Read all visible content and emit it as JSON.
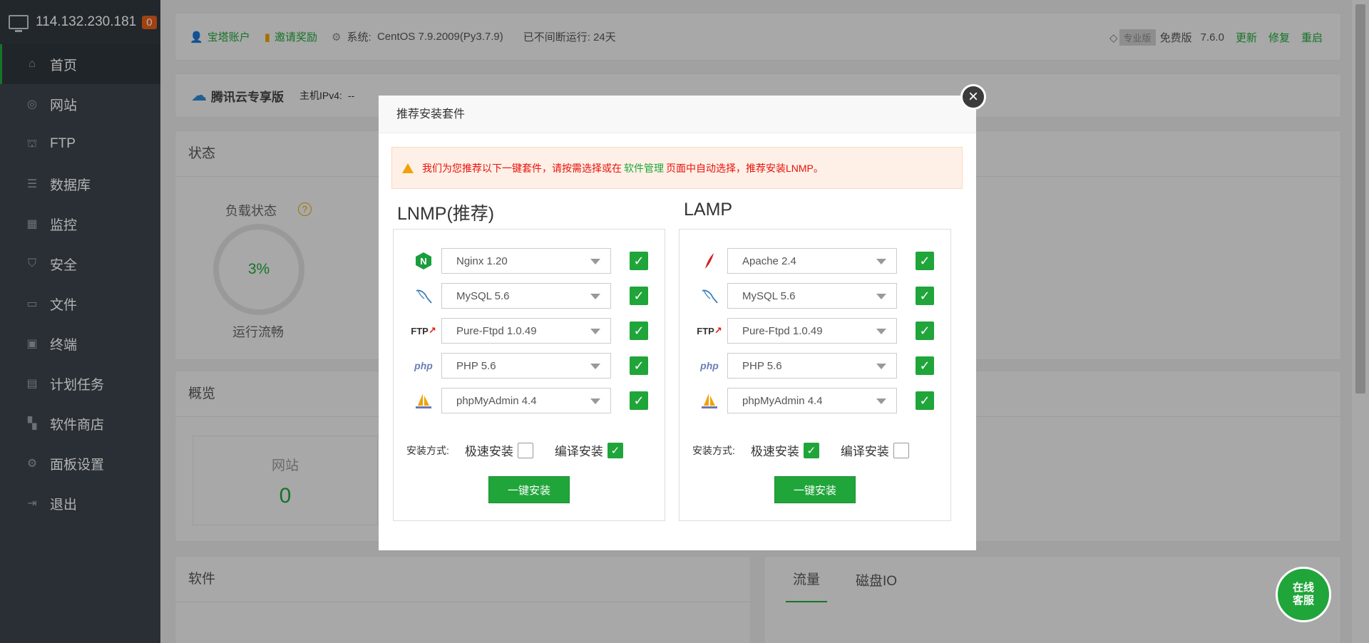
{
  "sidebar": {
    "ip": "114.132.230.181",
    "badge": "0",
    "items": [
      {
        "label": "首页",
        "icon": "home-icon"
      },
      {
        "label": "网站",
        "icon": "globe-icon"
      },
      {
        "label": "FTP",
        "icon": "ftp-icon"
      },
      {
        "label": "数据库",
        "icon": "database-icon"
      },
      {
        "label": "监控",
        "icon": "monitor-icon"
      },
      {
        "label": "安全",
        "icon": "shield-icon"
      },
      {
        "label": "文件",
        "icon": "folder-icon"
      },
      {
        "label": "终端",
        "icon": "terminal-icon"
      },
      {
        "label": "计划任务",
        "icon": "calendar-icon"
      },
      {
        "label": "软件商店",
        "icon": "grid-icon"
      },
      {
        "label": "面板设置",
        "icon": "gear-icon"
      },
      {
        "label": "退出",
        "icon": "logout-icon"
      }
    ]
  },
  "topbar": {
    "account": "宝塔账户",
    "invite": "邀请奖励",
    "system_label": "系统:",
    "system_value": "CentOS 7.9.2009(Py3.7.9)",
    "uptime": "已不间断运行: 24天",
    "pro": "专业版",
    "free": "免费版",
    "version": "7.6.0",
    "update": "更新",
    "repair": "修复",
    "restart": "重启"
  },
  "tencent": {
    "brand": "腾讯云专享版",
    "host_label": "主机IPv4:",
    "host_value": "--"
  },
  "status": {
    "title": "状态",
    "load_label": "负载状态",
    "load_value": "3%",
    "load_state": "运行流畅"
  },
  "overview": {
    "title": "概览",
    "site_label": "网站",
    "site_value": "0"
  },
  "software": {
    "title": "软件"
  },
  "traffic": {
    "tab1": "流量",
    "tab2": "磁盘IO"
  },
  "modal": {
    "title": "推荐安装套件",
    "notice_before": "我们为您推荐以下一键套件，请按需选择或在",
    "notice_link": "软件管理",
    "notice_after": "页面中自动选择，推荐安装LNMP。",
    "lnmp": {
      "title": "LNMP(推荐)",
      "rows": [
        {
          "icon": "nginx-icon",
          "value": "Nginx 1.20",
          "checked": true
        },
        {
          "icon": "mysql-icon",
          "value": "MySQL 5.6",
          "checked": true
        },
        {
          "icon": "ftp-logo-icon",
          "value": "Pure-Ftpd 1.0.49",
          "checked": true
        },
        {
          "icon": "php-icon",
          "value": "PHP 5.6",
          "checked": true
        },
        {
          "icon": "phpmyadmin-icon",
          "value": "phpMyAdmin 4.4",
          "checked": true
        }
      ],
      "method_label": "安装方式:",
      "fast": "极速安装",
      "compile": "编译安装",
      "fast_checked": false,
      "compile_checked": true,
      "install": "一键安装"
    },
    "lamp": {
      "title": "LAMP",
      "rows": [
        {
          "icon": "apache-icon",
          "value": "Apache 2.4",
          "checked": true
        },
        {
          "icon": "mysql-icon",
          "value": "MySQL 5.6",
          "checked": true
        },
        {
          "icon": "ftp-logo-icon",
          "value": "Pure-Ftpd 1.0.49",
          "checked": true
        },
        {
          "icon": "php-icon",
          "value": "PHP 5.6",
          "checked": true
        },
        {
          "icon": "phpmyadmin-icon",
          "value": "phpMyAdmin 4.4",
          "checked": true
        }
      ],
      "method_label": "安装方式:",
      "fast": "极速安装",
      "compile": "编译安装",
      "fast_checked": true,
      "compile_checked": false,
      "install": "一键安装"
    }
  },
  "chat": {
    "line1": "在线",
    "line2": "客服"
  }
}
